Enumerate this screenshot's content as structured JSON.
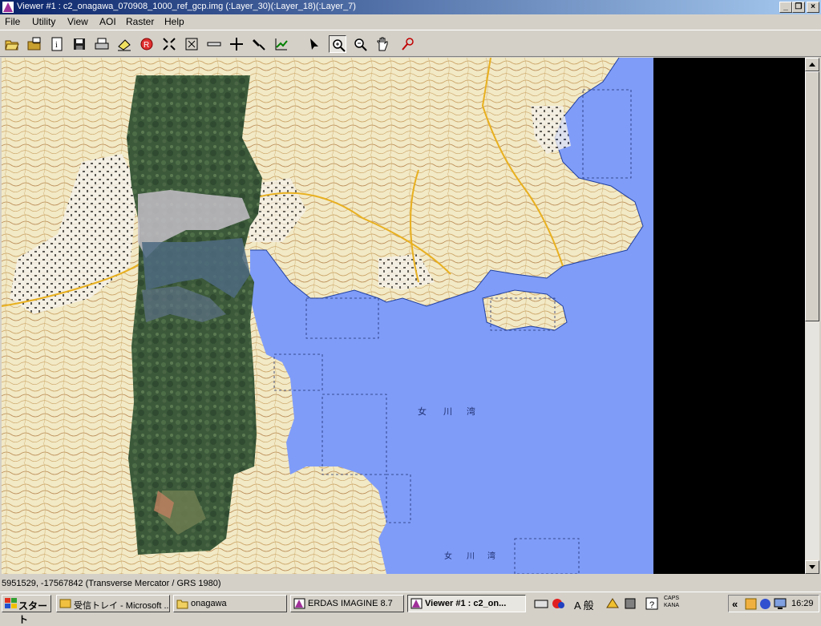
{
  "window": {
    "title": "Viewer #1 : c2_onagawa_070908_1000_ref_gcp.img (:Layer_30)(:Layer_18)(:Layer_7)"
  },
  "menu": [
    "File",
    "Utility",
    "View",
    "AOI",
    "Raster",
    "Help"
  ],
  "toolbar": {
    "tools": [
      "open-icon",
      "open-layer-icon",
      "info-icon",
      "save-icon",
      "print-icon",
      "eraser-icon",
      "clear-icon",
      "fit-icon",
      "zoom-fit-icon",
      "measure-icon",
      "crosshair-icon",
      "tools-icon",
      "chart-icon",
      "select-icon",
      "zoom-in-icon",
      "zoom-out-icon",
      "pan-icon",
      "inquire-icon"
    ],
    "active_tool": "zoom-in-icon"
  },
  "map": {
    "labels": [
      "女",
      "川",
      "湾",
      "女",
      "川",
      "湾"
    ]
  },
  "status": {
    "text": "5951529, -17567842    (Transverse Mercator / GRS 1980)"
  },
  "taskbar": {
    "start_label": "スタート",
    "tasks": [
      {
        "label": "受信トレイ - Microsoft ...",
        "icon": "outlook-icon"
      },
      {
        "label": "onagawa",
        "icon": "folder-icon"
      },
      {
        "label": "ERDAS IMAGINE 8.7",
        "icon": "erdas-icon"
      },
      {
        "label": "Viewer #1 : c2_on...",
        "icon": "erdas-icon"
      }
    ],
    "ime": {
      "mode": "A 般",
      "caps": "CAPS",
      "kana": "KANA"
    },
    "tray_expand": "«",
    "clock": "16:29"
  },
  "colors": {
    "sea": "#7f9cf8",
    "land": "#f2e9c6",
    "titlebar": "#0a246a"
  }
}
